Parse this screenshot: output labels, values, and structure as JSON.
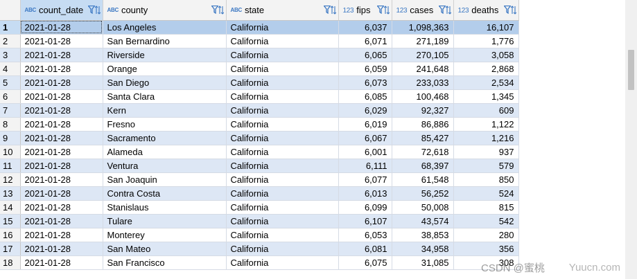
{
  "columns": [
    {
      "type_label": "ABC",
      "name": "count_date"
    },
    {
      "type_label": "ABC",
      "name": "county"
    },
    {
      "type_label": "ABC",
      "name": "state"
    },
    {
      "type_label": "123",
      "name": "fips"
    },
    {
      "type_label": "123",
      "name": "cases"
    },
    {
      "type_label": "123",
      "name": "deaths"
    }
  ],
  "rows": [
    {
      "n": "1",
      "count_date": "2021-01-28",
      "county": "Los Angeles",
      "state": "California",
      "fips": "6,037",
      "cases": "1,098,363",
      "deaths": "16,107"
    },
    {
      "n": "2",
      "count_date": "2021-01-28",
      "county": "San Bernardino",
      "state": "California",
      "fips": "6,071",
      "cases": "271,189",
      "deaths": "1,776"
    },
    {
      "n": "3",
      "count_date": "2021-01-28",
      "county": "Riverside",
      "state": "California",
      "fips": "6,065",
      "cases": "270,105",
      "deaths": "3,058"
    },
    {
      "n": "4",
      "count_date": "2021-01-28",
      "county": "Orange",
      "state": "California",
      "fips": "6,059",
      "cases": "241,648",
      "deaths": "2,868"
    },
    {
      "n": "5",
      "count_date": "2021-01-28",
      "county": "San Diego",
      "state": "California",
      "fips": "6,073",
      "cases": "233,033",
      "deaths": "2,534"
    },
    {
      "n": "6",
      "count_date": "2021-01-28",
      "county": "Santa Clara",
      "state": "California",
      "fips": "6,085",
      "cases": "100,468",
      "deaths": "1,345"
    },
    {
      "n": "7",
      "count_date": "2021-01-28",
      "county": "Kern",
      "state": "California",
      "fips": "6,029",
      "cases": "92,327",
      "deaths": "609"
    },
    {
      "n": "8",
      "count_date": "2021-01-28",
      "county": "Fresno",
      "state": "California",
      "fips": "6,019",
      "cases": "86,886",
      "deaths": "1,122"
    },
    {
      "n": "9",
      "count_date": "2021-01-28",
      "county": "Sacramento",
      "state": "California",
      "fips": "6,067",
      "cases": "85,427",
      "deaths": "1,216"
    },
    {
      "n": "10",
      "count_date": "2021-01-28",
      "county": "Alameda",
      "state": "California",
      "fips": "6,001",
      "cases": "72,618",
      "deaths": "937"
    },
    {
      "n": "11",
      "count_date": "2021-01-28",
      "county": "Ventura",
      "state": "California",
      "fips": "6,111",
      "cases": "68,397",
      "deaths": "579"
    },
    {
      "n": "12",
      "count_date": "2021-01-28",
      "county": "San Joaquin",
      "state": "California",
      "fips": "6,077",
      "cases": "61,548",
      "deaths": "850"
    },
    {
      "n": "13",
      "count_date": "2021-01-28",
      "county": "Contra Costa",
      "state": "California",
      "fips": "6,013",
      "cases": "56,252",
      "deaths": "524"
    },
    {
      "n": "14",
      "count_date": "2021-01-28",
      "county": "Stanislaus",
      "state": "California",
      "fips": "6,099",
      "cases": "50,008",
      "deaths": "815"
    },
    {
      "n": "15",
      "count_date": "2021-01-28",
      "county": "Tulare",
      "state": "California",
      "fips": "6,107",
      "cases": "43,574",
      "deaths": "542"
    },
    {
      "n": "16",
      "count_date": "2021-01-28",
      "county": "Monterey",
      "state": "California",
      "fips": "6,053",
      "cases": "38,853",
      "deaths": "280"
    },
    {
      "n": "17",
      "count_date": "2021-01-28",
      "county": "San Mateo",
      "state": "California",
      "fips": "6,081",
      "cases": "34,958",
      "deaths": "356"
    },
    {
      "n": "18",
      "count_date": "2021-01-28",
      "county": "San Francisco",
      "state": "California",
      "fips": "6,075",
      "cases": "31,085",
      "deaths": "308"
    }
  ],
  "watermark": {
    "left": "CSDN @蜜桃",
    "right": "Yuucn.com"
  },
  "colors": {
    "selected_row": "#b3cdeb",
    "alt_row": "#dde7f5",
    "header_active": "#c6dcf3",
    "type_icon": "#3c78c3"
  },
  "icons": {
    "column_header": [
      "filter-icon",
      "sort-icon"
    ]
  }
}
